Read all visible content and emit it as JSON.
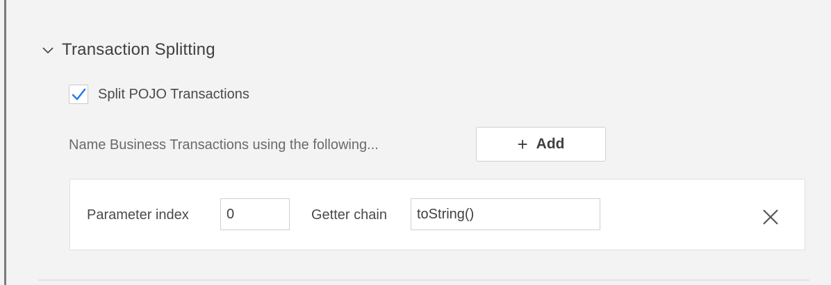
{
  "section": {
    "title": "Transaction Splitting",
    "expanded": true
  },
  "split_pojo": {
    "label": "Split POJO Transactions",
    "checked": true
  },
  "naming": {
    "label": "Name Business Transactions using the following...",
    "add_button_label": "Add"
  },
  "rule": {
    "parameter_index_label": "Parameter index",
    "parameter_index_value": "0",
    "getter_chain_label": "Getter chain",
    "getter_chain_value": "toString()"
  },
  "colors": {
    "accent": "#2a7de1",
    "background": "#f3f3f3"
  },
  "icons": {
    "chevron": "chevron-down-icon",
    "check": "check-icon",
    "plus": "plus-icon",
    "close": "close-icon"
  }
}
